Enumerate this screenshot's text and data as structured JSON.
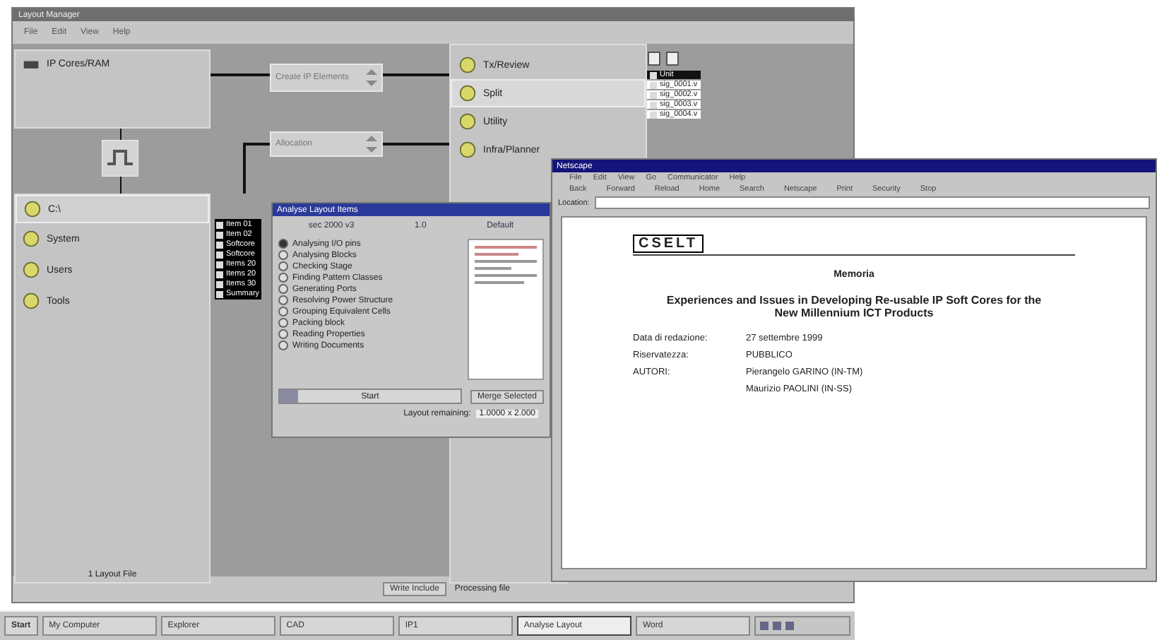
{
  "main_window": {
    "title": "Layout Manager",
    "menu": [
      "File",
      "Edit",
      "View",
      "Help"
    ],
    "source_panel": {
      "label": "IP Cores/RAM"
    },
    "steps": [
      {
        "label": "Create IP Elements"
      },
      {
        "label": "Allocation"
      }
    ],
    "targets": [
      {
        "label": "Tx/Review",
        "selected": false
      },
      {
        "label": "Split",
        "selected": true
      },
      {
        "label": "Utility",
        "selected": false
      },
      {
        "label": "Infra/Planner",
        "selected": false
      }
    ],
    "files": [
      {
        "label": "Unit",
        "selected": true
      },
      {
        "label": "sig_0001.v",
        "selected": false
      },
      {
        "label": "sig_0002.v",
        "selected": false
      },
      {
        "label": "sig_0003.v",
        "selected": false
      },
      {
        "label": "sig_0004.v",
        "selected": false
      }
    ],
    "tree": {
      "root": "C:\\",
      "items": [
        "System",
        "Users",
        "Tools"
      ]
    },
    "layer_list": [
      "Item 01",
      "Item 02",
      "Softcore",
      "Softcore",
      "Items 20",
      "Items 20",
      "Items 30",
      "Summary"
    ],
    "panel_footer": "1 Layout File",
    "bottom_button": "Write Include",
    "bottom_status": "Processing file"
  },
  "dialog": {
    "title": "Analyse Layout Items",
    "header": [
      "sec 2000 v3",
      "1.0",
      "Default"
    ],
    "options": [
      {
        "label": "Analysing I/O pins",
        "selected": true
      },
      {
        "label": "Analysing Blocks",
        "selected": false
      },
      {
        "label": "Checking Stage",
        "selected": false
      },
      {
        "label": "Finding Pattern Classes",
        "selected": false
      },
      {
        "label": "Generating Ports",
        "selected": false
      },
      {
        "label": "Resolving Power Structure",
        "selected": false
      },
      {
        "label": "Grouping Equivalent Cells",
        "selected": false
      },
      {
        "label": "Packing block",
        "selected": false
      },
      {
        "label": "Reading Properties",
        "selected": false
      },
      {
        "label": "Writing Documents",
        "selected": false
      }
    ],
    "progress": {
      "label": "Start",
      "level": 0.1
    },
    "merge_button": "Merge Selected",
    "footer_label": "Layout remaining:",
    "footer_value": "1.0000 x 2.000"
  },
  "browser": {
    "title": "Netscape",
    "menu": [
      "File",
      "Edit",
      "View",
      "Go",
      "Communicator",
      "Help"
    ],
    "toolbar": [
      "Back",
      "Forward",
      "Reload",
      "Home",
      "Search",
      "Netscape",
      "Print",
      "Security",
      "Stop"
    ],
    "location_label": "Location:",
    "document": {
      "logo": "CSELT",
      "kind_title": "Memoria",
      "title": "Experiences and Issues in Developing Re-usable IP Soft Cores for the New Millennium ICT Products",
      "fields": [
        {
          "label": "Data di redazione:",
          "value": "27 settembre 1999"
        },
        {
          "label": "Riservatezza:",
          "value": "PUBBLICO"
        },
        {
          "label": "AUTORI:",
          "value": "Pierangelo GARINO (IN-TM)"
        },
        {
          "value": "Maurizio PAOLINI (IN-SS)"
        }
      ]
    }
  },
  "taskbar": {
    "start": "Start",
    "tasks": [
      {
        "label": "My Computer",
        "selected": false
      },
      {
        "label": "Explorer",
        "selected": false
      },
      {
        "label": "CAD",
        "selected": false
      },
      {
        "label": "IP1",
        "selected": false
      },
      {
        "label": "Analyse Layout",
        "selected": true
      },
      {
        "label": "Word",
        "selected": false
      }
    ]
  }
}
